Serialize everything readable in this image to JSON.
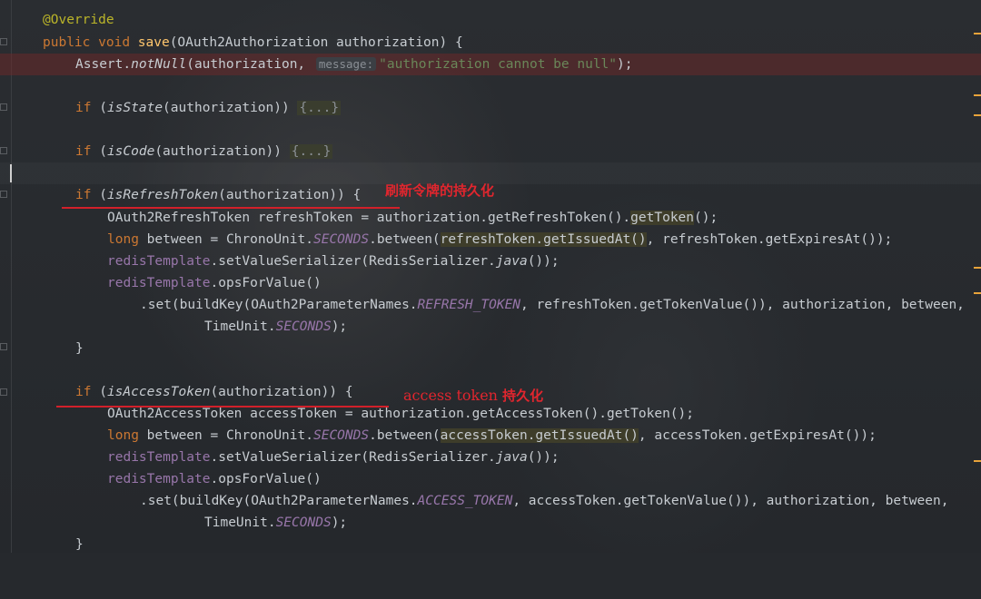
{
  "code": {
    "l1_annotation": "@Override",
    "l2_public": "public",
    "l2_void": "void",
    "l2_method": "save",
    "l2_rest": "(OAuth2Authorization authorization) {",
    "l3_assert": "Assert.",
    "l3_notnull": "notNull",
    "l3_arg": "(authorization, ",
    "l3_hint": "message:",
    "l3_str": "\"authorization cannot be null\"",
    "l3_end": ");",
    "l4_if": "if",
    "l4_open": " (",
    "l4_fn": "isState",
    "l4_arg": "(authorization)) ",
    "l4_fold": "{...}",
    "l5_if": "if",
    "l5_open": " (",
    "l5_fn": "isCode",
    "l5_arg": "(authorization)) ",
    "l5_fold": "{...}",
    "l6_if": "if",
    "l6_open": " (",
    "l6_fn": "isRefreshToken",
    "l6_arg": "(authorization)) {",
    "l7_text": "OAuth2RefreshToken refreshToken = authorization.getRefreshToken().",
    "l7_hl": "getToken",
    "l7_end": "();",
    "l8_long": "long",
    "l8_a": " between = ChronoUnit.",
    "l8_const": "SECONDS",
    "l8_b": ".between(",
    "l8_hl": "refreshToken.getIssuedAt()",
    "l8_c": ", refreshToken.getExpiresAt());",
    "l9_field": "redisTemplate",
    "l9_a": ".setValueSerializer(RedisSerializer.",
    "l9_java": "java",
    "l9_b": "());",
    "l10_field": "redisTemplate",
    "l10_a": ".opsForValue()",
    "l11_a": ".set(buildKey(OAuth2ParameterNames.",
    "l11_const": "REFRESH_TOKEN",
    "l11_b": ", refreshToken.getTokenValue()), authorization, between,",
    "l12_a": "TimeUnit.",
    "l12_const": "SECONDS",
    "l12_b": ");",
    "l13": "}",
    "l14_if": "if",
    "l14_open": " (",
    "l14_fn": "isAccessToken",
    "l14_arg": "(authorization)) {",
    "l15_text": "OAuth2AccessToken accessToken = authorization.getAccessToken().getToken();",
    "l16_long": "long",
    "l16_a": " between = ChronoUnit.",
    "l16_const": "SECONDS",
    "l16_b": ".between(",
    "l16_hl": "accessToken.getIssuedAt()",
    "l16_c": ", accessToken.getExpiresAt());",
    "l17_field": "redisTemplate",
    "l17_a": ".setValueSerializer(RedisSerializer.",
    "l17_java": "java",
    "l17_b": "());",
    "l18_field": "redisTemplate",
    "l18_a": ".opsForValue()",
    "l19_a": ".set(buildKey(OAuth2ParameterNames.",
    "l19_const": "ACCESS_TOKEN",
    "l19_b": ", accessToken.getTokenValue()), authorization, between,",
    "l20_a": "TimeUnit.",
    "l20_const": "SECONDS",
    "l20_b": ");",
    "l21": "}"
  },
  "annotations": {
    "refresh_note": "刷新令牌的持久化",
    "access_note_latin": "access token",
    "access_note_cjk": "持久化"
  },
  "colors": {
    "annotation_red": "#d2202a",
    "error_line_bg": "#5a2a2a",
    "keyword": "#cc7832",
    "method_name": "#ffc66d",
    "constant": "#9876aa",
    "string": "#6a8759"
  }
}
